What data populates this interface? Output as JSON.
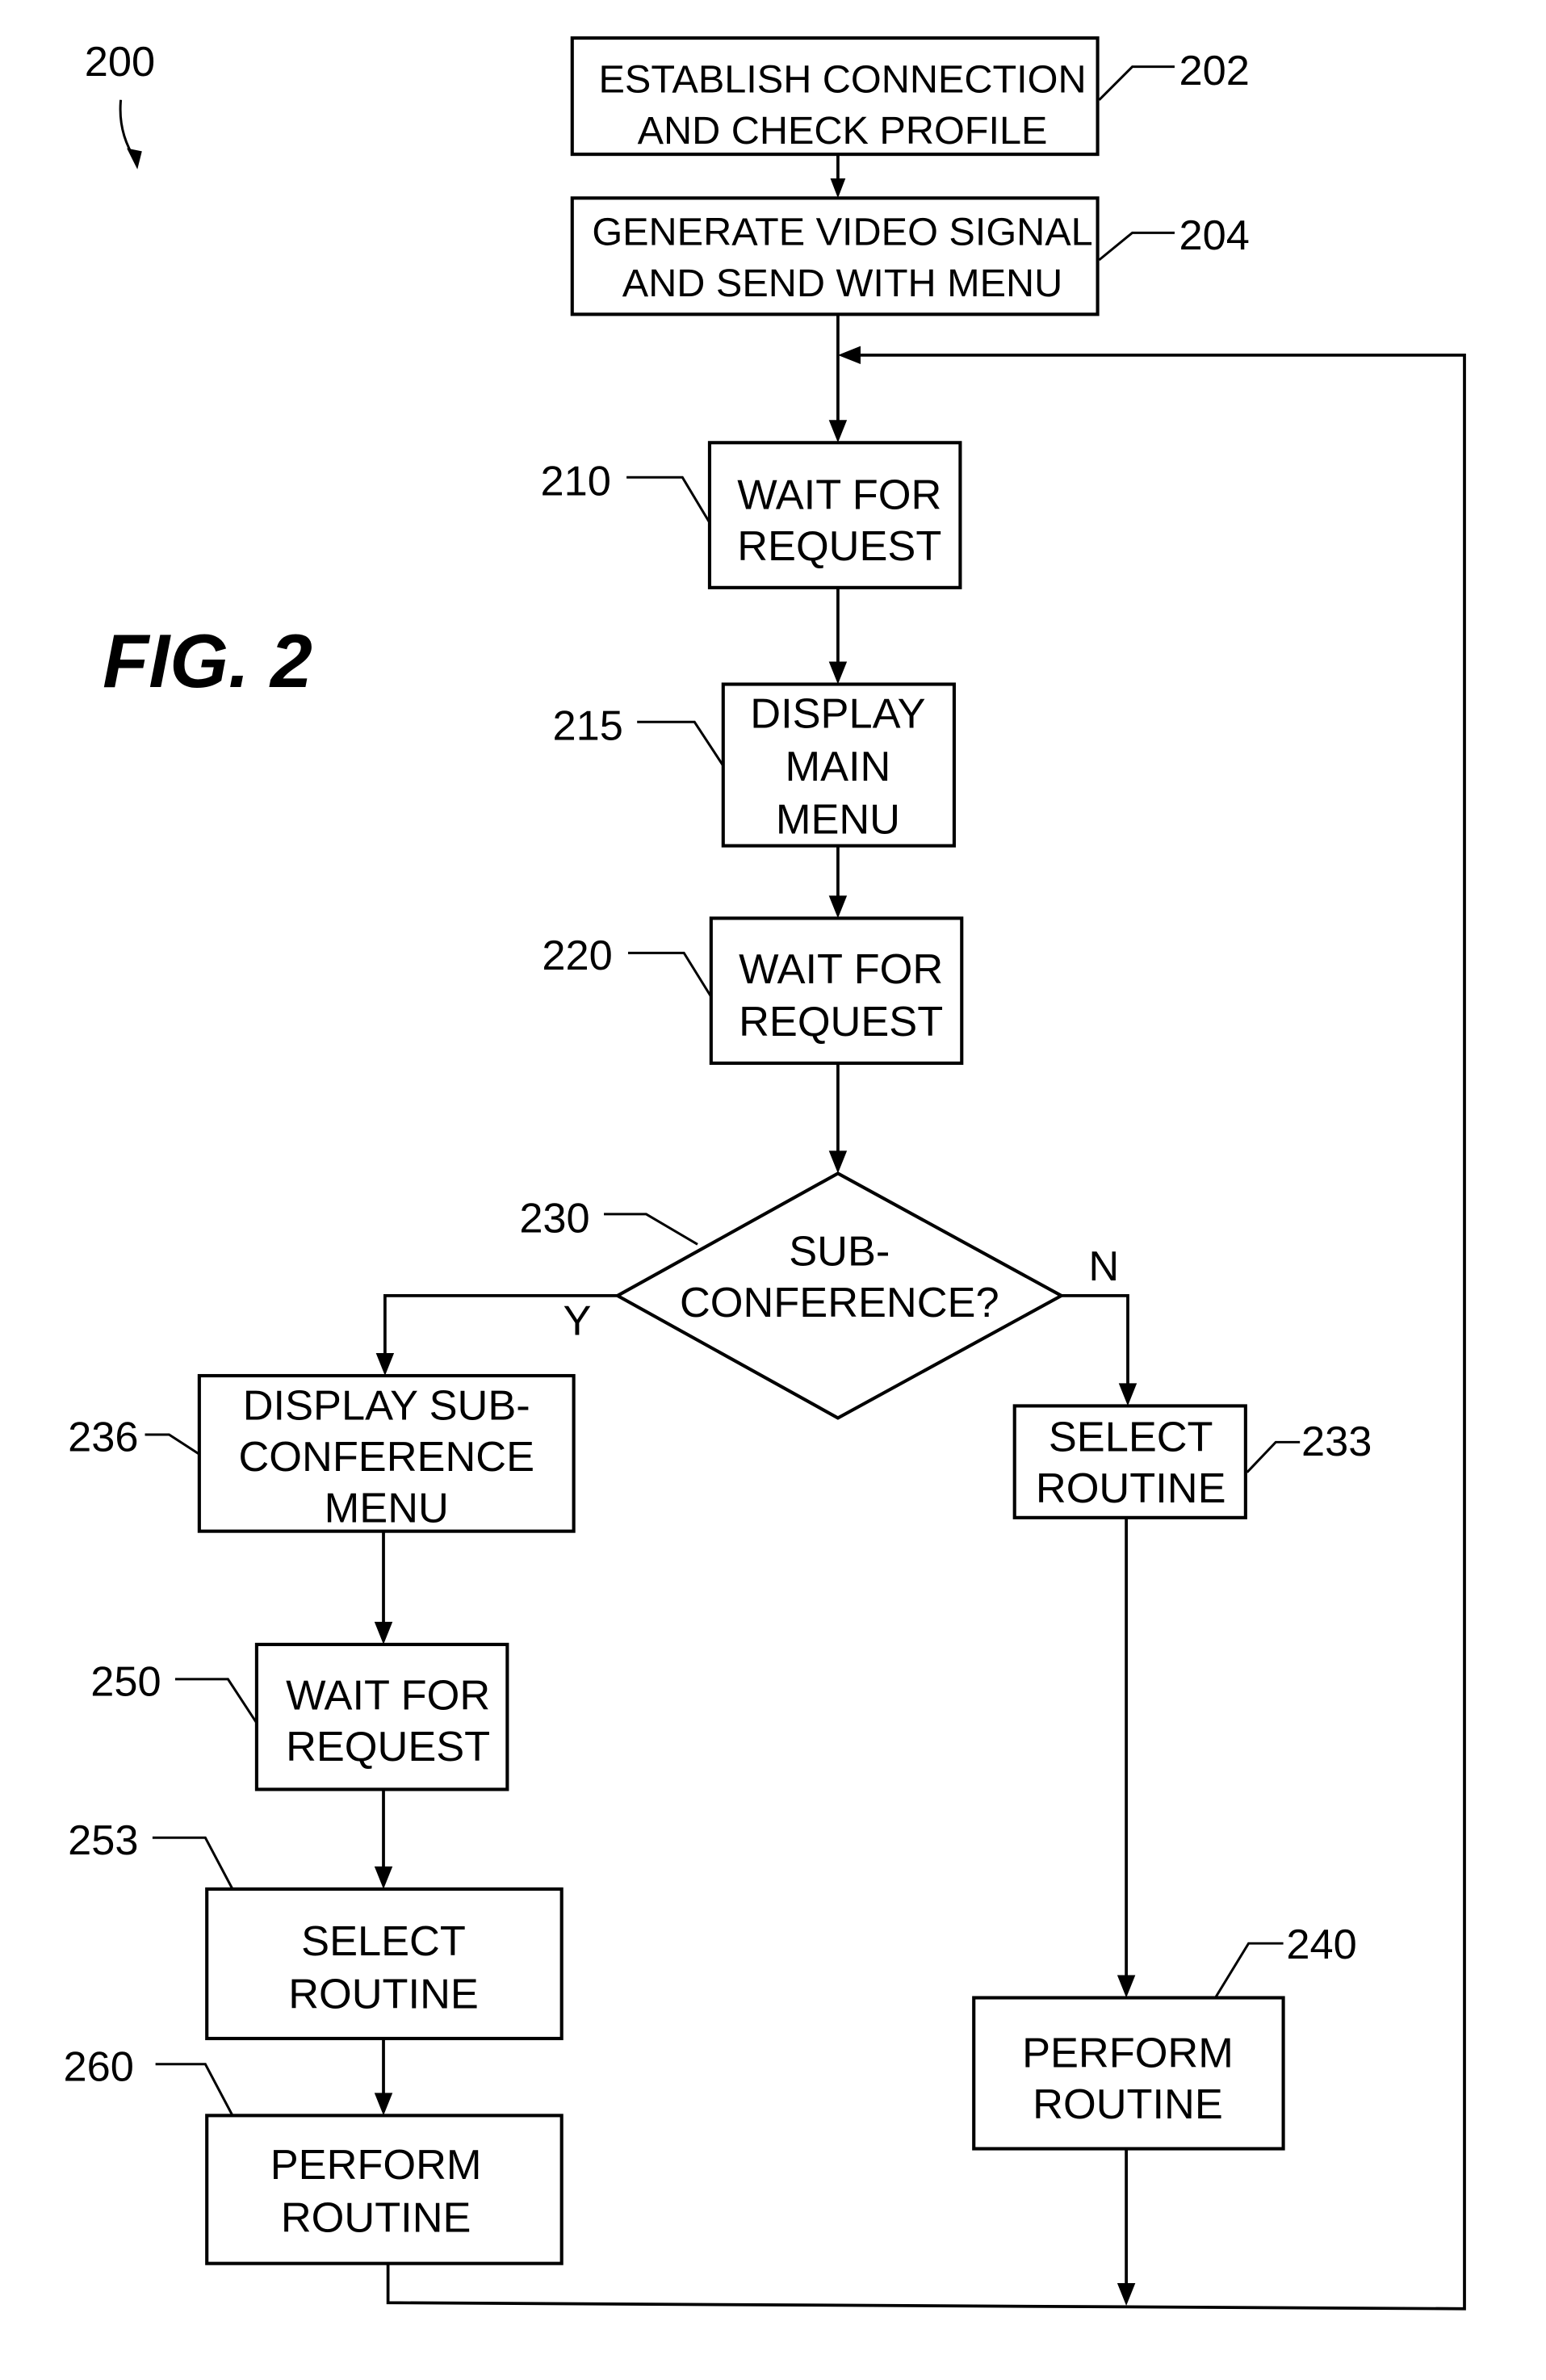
{
  "figure": {
    "title": "FIG. 2",
    "reference": "200"
  },
  "nodes": {
    "n202": {
      "ref": "202",
      "lines": [
        "ESTABLISH CONNECTION",
        "AND CHECK PROFILE"
      ]
    },
    "n204": {
      "ref": "204",
      "lines": [
        "GENERATE VIDEO SIGNAL",
        "AND SEND WITH MENU"
      ]
    },
    "n210": {
      "ref": "210",
      "lines": [
        "WAIT FOR",
        "REQUEST"
      ]
    },
    "n215": {
      "ref": "215",
      "lines": [
        "DISPLAY",
        "MAIN",
        "MENU"
      ]
    },
    "n220": {
      "ref": "220",
      "lines": [
        "WAIT FOR",
        "REQUEST"
      ]
    },
    "n230": {
      "ref": "230",
      "lines": [
        "SUB-",
        "CONFERENCE?"
      ],
      "shape": "decision"
    },
    "n233": {
      "ref": "233",
      "lines": [
        "SELECT",
        "ROUTINE"
      ]
    },
    "n236": {
      "ref": "236",
      "lines": [
        "DISPLAY SUB-",
        "CONFERENCE",
        "MENU"
      ]
    },
    "n240": {
      "ref": "240",
      "lines": [
        "PERFORM",
        "ROUTINE"
      ]
    },
    "n250": {
      "ref": "250",
      "lines": [
        "WAIT FOR",
        "REQUEST"
      ]
    },
    "n253": {
      "ref": "253",
      "lines": [
        "SELECT",
        "ROUTINE"
      ]
    },
    "n260": {
      "ref": "260",
      "lines": [
        "PERFORM",
        "ROUTINE"
      ]
    }
  },
  "branches": {
    "yes": "Y",
    "no": "N"
  },
  "edges": [
    {
      "from": "202",
      "to": "204"
    },
    {
      "from": "204",
      "to": "210"
    },
    {
      "from": "210",
      "to": "215"
    },
    {
      "from": "215",
      "to": "220"
    },
    {
      "from": "220",
      "to": "230"
    },
    {
      "from": "230",
      "to": "236",
      "label": "Y"
    },
    {
      "from": "230",
      "to": "233",
      "label": "N"
    },
    {
      "from": "236",
      "to": "250"
    },
    {
      "from": "250",
      "to": "253"
    },
    {
      "from": "253",
      "to": "260"
    },
    {
      "from": "233",
      "to": "240"
    },
    {
      "from": "260",
      "to": "210",
      "note": "loop back"
    },
    {
      "from": "240",
      "to": "210",
      "note": "loop back"
    }
  ]
}
